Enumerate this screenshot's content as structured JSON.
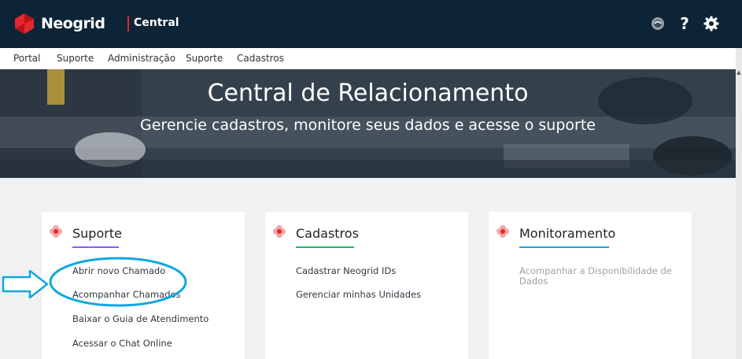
{
  "header": {
    "brand": "Neogrid",
    "product": "Central",
    "icons": [
      "neogrid-user-icon",
      "help-icon",
      "gear-icon"
    ],
    "brand_color": "#e3262f",
    "bg_color": "#0d2436"
  },
  "nav": {
    "items": [
      {
        "label": "Portal"
      },
      {
        "label": "Suporte"
      },
      {
        "label": "Administração"
      },
      {
        "label": "Suporte"
      },
      {
        "label": "Cadastros"
      }
    ]
  },
  "hero": {
    "title": "Central de Relacionamento",
    "subtitle": "Gerencie cadastros, monitore seus dados e acesse o suporte"
  },
  "cards": [
    {
      "title": "Suporte",
      "accent": "#8b5cf6",
      "links": [
        "Abrir novo Chamado",
        "Acompanhar Chamados",
        "Baixar o Guia de Atendimento",
        "Acessar o Chat Online"
      ]
    },
    {
      "title": "Cadastros",
      "accent": "#22b573",
      "links": [
        "Cadastrar Neogrid IDs",
        "Gerenciar minhas Unidades"
      ]
    },
    {
      "title": "Monitoramento",
      "accent": "#1fa0d8",
      "links": [
        "Acompanhar a Disponibilidade de Dados"
      ]
    }
  ],
  "annotation": {
    "color": "#11a7e0"
  }
}
